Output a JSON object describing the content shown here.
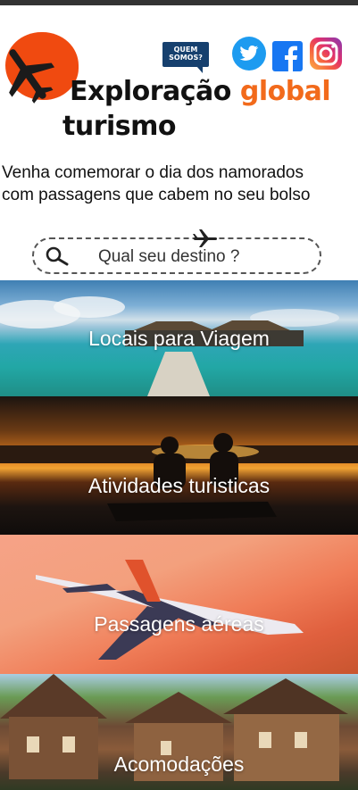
{
  "header": {
    "quem_somos": "QUEM\nSOMOS?",
    "quem_somos_line1": "QUEM",
    "quem_somos_line2": "SOMOS?",
    "social_icons": [
      "twitter-icon",
      "facebook-icon",
      "instagram-icon"
    ]
  },
  "brand": {
    "title_part1": "Exploração ",
    "title_accent": "global",
    "title_line2": "turismo",
    "accent_color": "#f26a1b",
    "logo_color": "#f04a10"
  },
  "subtitle": {
    "line1": "Venha comemorar o dia dos namorados",
    "line2": "com passagens que cabem no seu bolso"
  },
  "search": {
    "placeholder": "Qual seu destino ?"
  },
  "categories": [
    {
      "label": "Locais para Viagem"
    },
    {
      "label": "Atividades turisticas"
    },
    {
      "label": "Passagens aéreas"
    },
    {
      "label": "Acomodações"
    }
  ]
}
